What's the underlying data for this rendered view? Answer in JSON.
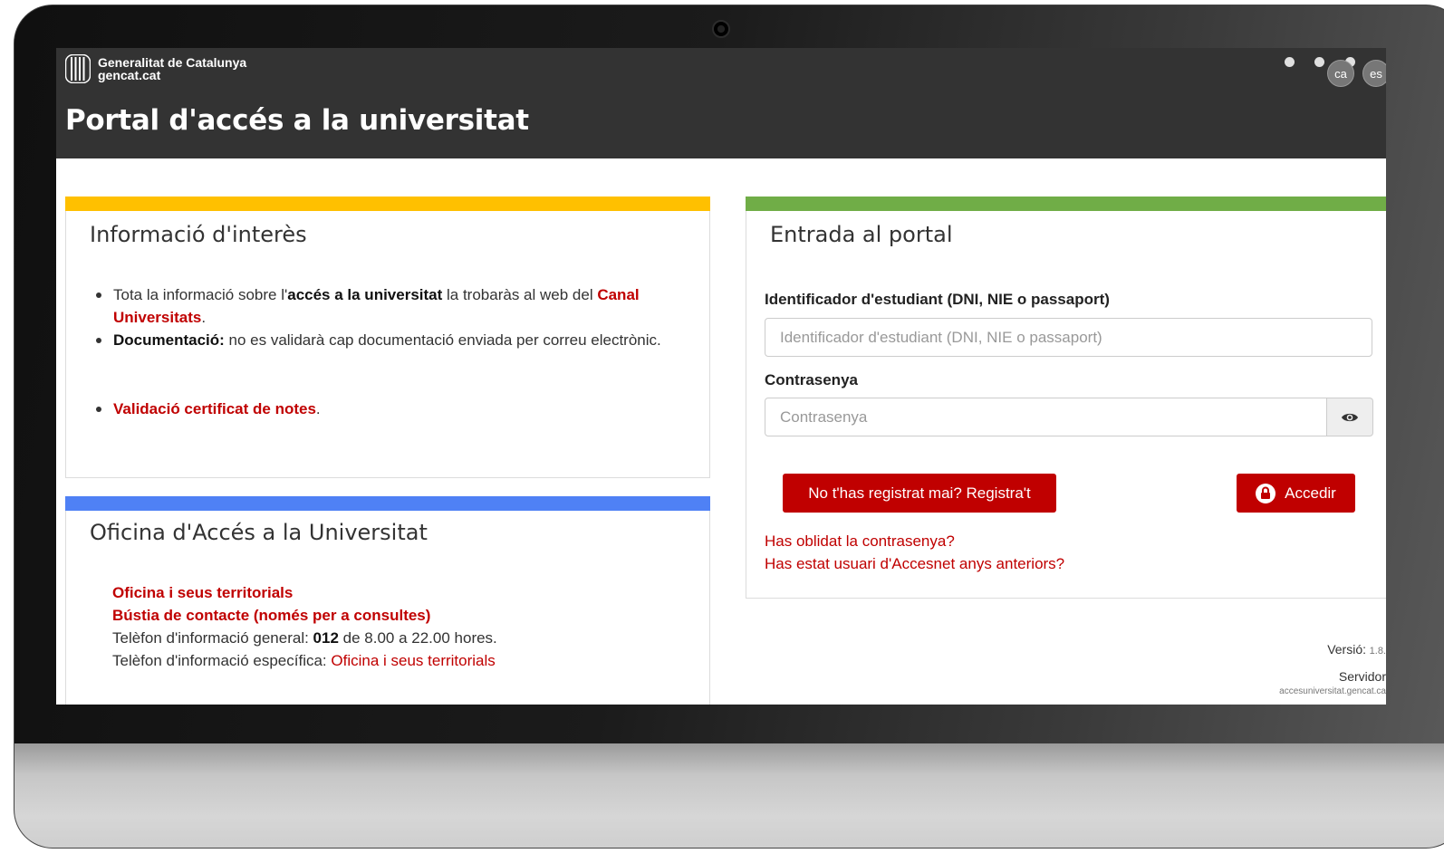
{
  "header": {
    "brand_line1": "Generalitat de Catalunya",
    "brand_line2": "gencat.cat",
    "title": "Portal d'accés a la universitat",
    "languages": [
      "ca",
      "es"
    ]
  },
  "info_panel": {
    "title": "Informació d'interès",
    "accent_color": "#ffc000",
    "item1": {
      "part1": "Tota la informació sobre l'",
      "bold": "accés a la universitat",
      "part2": " la trobaràs al web del ",
      "link": "Canal Universitats",
      "end": "."
    },
    "item2": {
      "bold": "Documentació:",
      "text": " no es validarà cap documentació enviada per correu electrònic."
    },
    "item3": {
      "link": "Validació certificat de notes",
      "end": "."
    }
  },
  "office_panel": {
    "title": "Oficina d'Accés a la Universitat",
    "accent_color": "#4f81f5",
    "link1": "Oficina i seus territorials",
    "link2": "Bústia de contacte (només per a consultes)",
    "phone_general_prefix": "Telèfon d'informació general: ",
    "phone_general_number": "012",
    "phone_general_suffix": " de 8.00 a 22.00 hores.",
    "phone_specific_prefix": "Telèfon d'informació específica: ",
    "phone_specific_link": "Oficina i seus territorials"
  },
  "login_panel": {
    "title": "Entrada al portal",
    "accent_color": "#70ad47",
    "id_label": "Identificador d'estudiant (DNI, NIE o passaport)",
    "id_placeholder": "Identificador d'estudiant (DNI, NIE o passaport)",
    "password_label": "Contrasenya",
    "password_placeholder": "Contrasenya",
    "register_button": "No t'has registrat mai? Registra't",
    "login_button": "Accedir",
    "forgot_link": "Has oblidat la contrasenya?",
    "accesnet_link": "Has estat usuari d'Accesnet anys anteriors?"
  },
  "footer": {
    "version_label": "Versió:",
    "version_value": "1.8.",
    "server_label": "Servidor",
    "server_value": "accesuniversitat.gencat.ca"
  },
  "colors": {
    "header_bg": "#333333",
    "primary_red": "#c00000"
  }
}
